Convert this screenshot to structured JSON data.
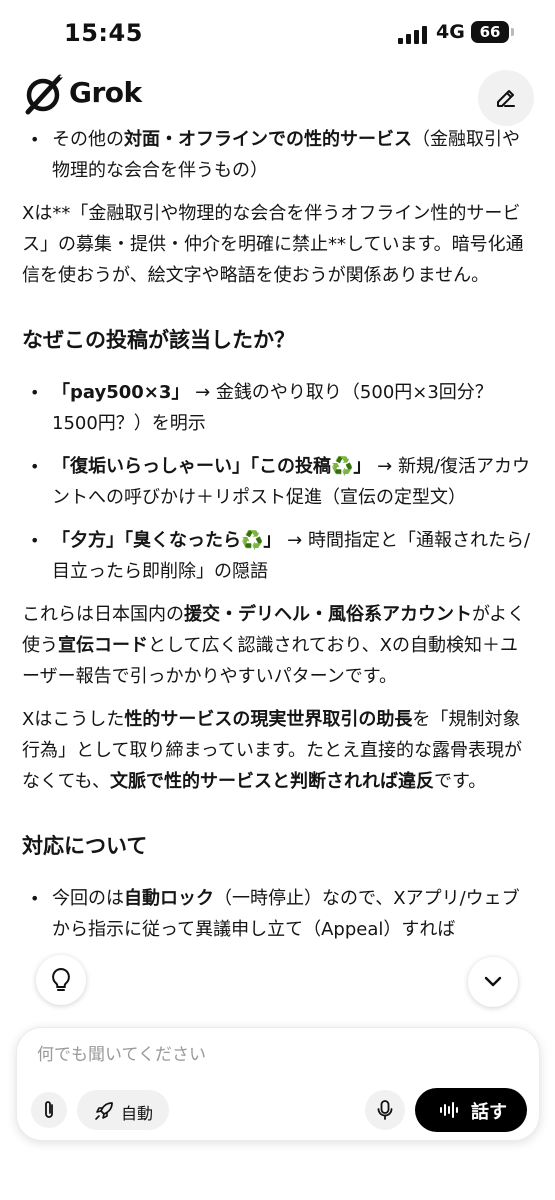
{
  "status_bar": {
    "time": "15:45",
    "network": "4G",
    "battery": "66"
  },
  "header": {
    "brand": "Grok"
  },
  "content": {
    "b1": [
      "その他の",
      "対面・オフラインでの性的サービス",
      "（金融取引や物理的な会合を伴うもの）"
    ],
    "p1": "Xは**「金融取引や物理的な会合を伴うオフライン性的サービス」の募集・提供・仲介を明確に禁止**しています。暗号化通信を使おうが、絵文字や略語を使おうが関係ありません。",
    "h_why": "なぜこの投稿が該当したか？",
    "w1": [
      "「pay500×3」",
      " → 金銭のやり取り（500円×3回分？1500円？）を明示"
    ],
    "w2": [
      "「復垢いらっしゃーい」「この投稿♻️」",
      " → 新規/復活アカウントへの呼びかけ＋リポスト促進（宣伝の定型文）"
    ],
    "w3": [
      "「夕方」「臭くなったら♻️」",
      " → 時間指定と「通報されたら/目立ったら即削除」の隠語"
    ],
    "p2": [
      "これらは日本国内の",
      "援交・デリヘル・風俗系アカウント",
      "がよく使う",
      "宣伝コード",
      "として広く認識されており、Xの自動検知＋ユーザー報告で引っかかりやすいパターンです。"
    ],
    "p3": [
      "Xはこうした",
      "性的サービスの現実世界取引の助長",
      "を「規制対象行為」として取り締まっています。たとえ直接的な露骨表現がなくても、",
      "文脈で性的サービスと判断されれば違反",
      "です。"
    ],
    "h_resp": "対応について",
    "r1": [
      "今回のは",
      "自動ロック",
      "（一時停止）なので、Xアプリ/ウェブから指示に従って異議申し立て（Appeal）すれば"
    ]
  },
  "composer": {
    "placeholder": "何でも聞いてください",
    "mode_label": "自動",
    "talk_label": "話す"
  }
}
